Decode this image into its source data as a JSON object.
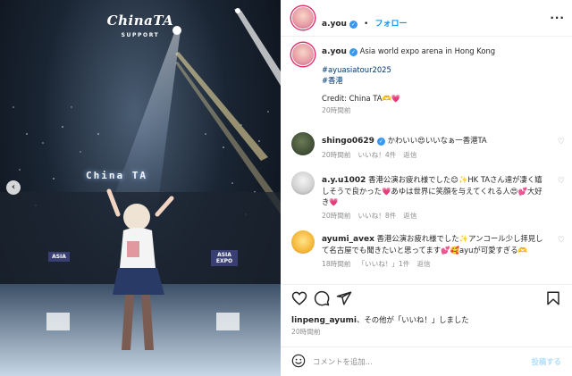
{
  "media": {
    "logo_text": "ChinaTA",
    "logo_sub": "SUPPORT",
    "led_text": "China TA",
    "side_ad_left": "ASIA",
    "side_ad_right": "ASIA EXPO",
    "prev_arrow": "‹"
  },
  "header": {
    "username": "a.you",
    "follow_label": "フォロー",
    "more_label": "···"
  },
  "caption": {
    "username": "a.you",
    "text": "Asia world expo arena in Hong Kong",
    "hashtags": [
      "#ayuasiatour2025",
      "#香港"
    ],
    "credit": "Credit: China TA🫶💗",
    "time": "20時間前"
  },
  "comments": [
    {
      "username": "shingo0629",
      "text": "かわいい😍いいなぁ一香港TA",
      "time": "20時間前",
      "likes": "いいね！4件",
      "reply": "返信"
    },
    {
      "username": "a.y.u1002",
      "text": "香港公演お疲れ様でした😊✨HK TAさん達が凄く嬉しそうで良かった💗あゆは世界に笑顔を与えてくれる人😍💕大好き💗",
      "time": "20時間前",
      "likes": "いいね！8件",
      "reply": "返信"
    },
    {
      "username": "ayumi_avex",
      "text": "香港公演お疲れ様でした✨アンコール少し拝見して名古屋でも聞きたいと思ってます💕🥰ayuが可愛すぎる🫶",
      "time": "18時間前",
      "likes": "「いいね！」1件",
      "reply": "返信"
    }
  ],
  "likes_line": {
    "user": "linpeng_ayumi",
    "rest": "、その他が「いいね！」しました",
    "time": "20時間前"
  },
  "add_comment": {
    "placeholder": "コメントを追加...",
    "post_label": "投稿する"
  },
  "colors": {
    "accent": "#0095f6",
    "verified": "#3897f0",
    "muted": "#8e8e8e"
  }
}
